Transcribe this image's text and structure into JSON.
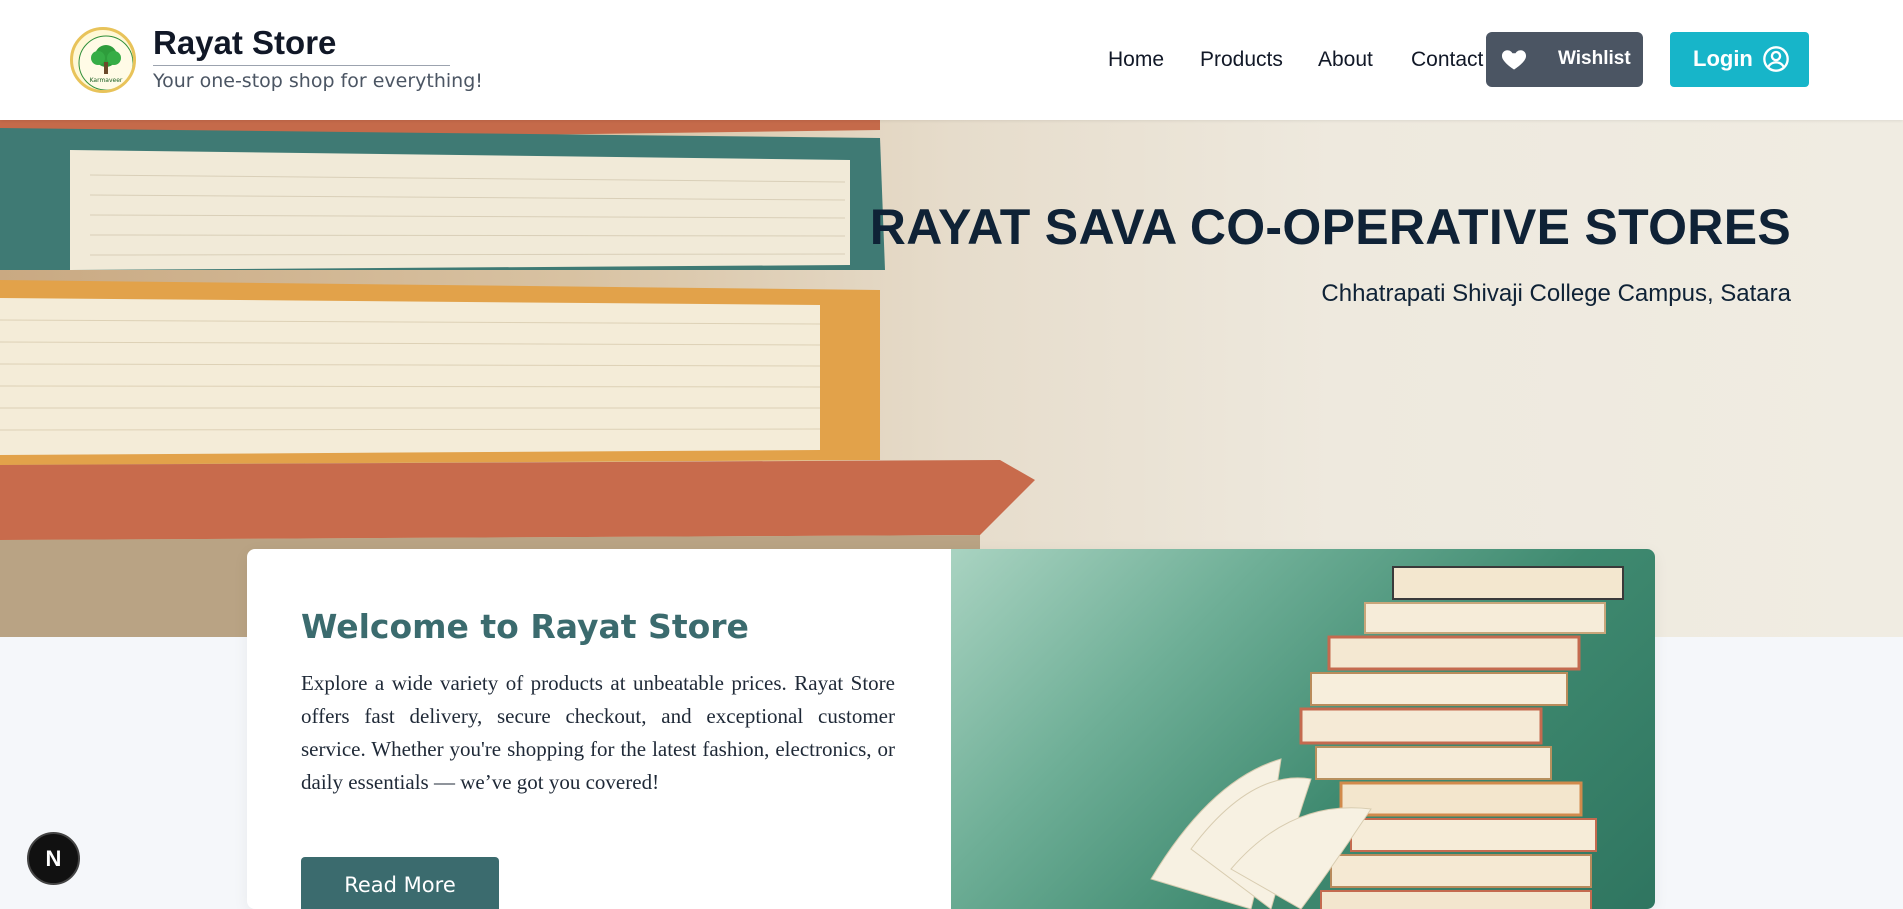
{
  "brand": {
    "title": "Rayat Store",
    "tagline": "Your one-stop shop for everything!",
    "logo_text": "Karmaveer"
  },
  "nav": {
    "links": [
      "Home",
      "Products",
      "About",
      "Contact"
    ],
    "wishlist_label": "Wishlist",
    "login_label": "Login"
  },
  "hero": {
    "title": "RAYAT SAVA CO-OPERATIVE STORES",
    "subtitle": "Chhatrapati Shivaji College Campus, Satara"
  },
  "welcome": {
    "title": "Welcome to Rayat Store",
    "body": "Explore a wide variety of products at unbeatable prices. Rayat Store offers fast delivery, secure checkout, and exceptional customer service. Whether you're shopping for the latest fashion, electronics, or daily essentials — we’ve got you covered!",
    "button": "Read More"
  },
  "dev_badge": "N",
  "icons": {
    "heart": "heart-icon",
    "user": "user-circle-icon"
  },
  "colors": {
    "teal": "#3b6b6e",
    "cyan": "#17b5c9",
    "slate": "#4b5563",
    "navy": "#0f2236"
  }
}
